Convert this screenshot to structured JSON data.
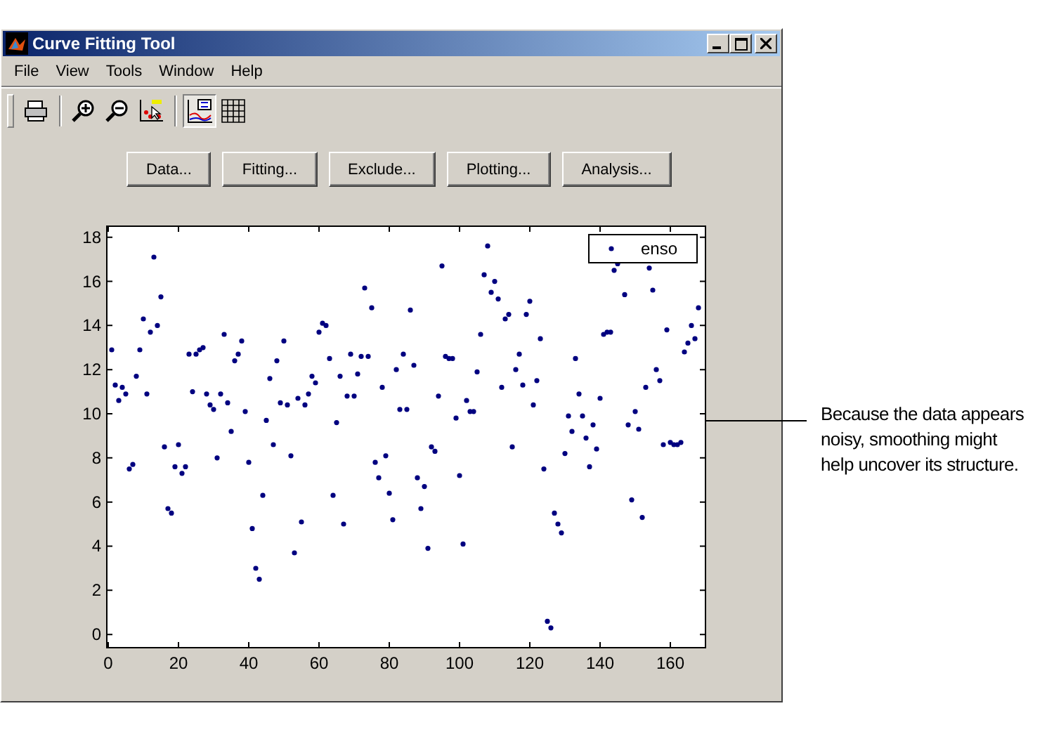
{
  "window": {
    "title": "Curve Fitting Tool"
  },
  "menu": [
    "File",
    "View",
    "Tools",
    "Window",
    "Help"
  ],
  "toolbar": [
    {
      "kind": "print",
      "pressed": false
    },
    {
      "kind": "zoom-in",
      "pressed": false
    },
    {
      "kind": "zoom-out",
      "pressed": false
    },
    {
      "kind": "data-cursor",
      "pressed": false
    },
    {
      "kind": "legend",
      "pressed": true
    },
    {
      "kind": "grid",
      "pressed": false
    }
  ],
  "buttons": [
    "Data...",
    "Fitting...",
    "Exclude...",
    "Plotting...",
    "Analysis..."
  ],
  "plot": {
    "chart_data": {
      "type": "scatter",
      "series": [
        {
          "name": "enso",
          "color": "#000080",
          "values": [
            12.9,
            11.3,
            10.6,
            11.2,
            10.9,
            7.5,
            7.7,
            11.7,
            12.9,
            14.3,
            10.9,
            13.7,
            17.1,
            14.0,
            15.3,
            8.5,
            5.7,
            5.5,
            7.6,
            8.6,
            7.3,
            7.6,
            12.7,
            11.0,
            12.7,
            12.9,
            13.0,
            10.9,
            10.4,
            10.2,
            8.0,
            10.9,
            13.6,
            10.5,
            9.2,
            12.4,
            12.7,
            13.3,
            10.1,
            7.8,
            4.8,
            3.0,
            2.5,
            6.3,
            9.7,
            11.6,
            8.6,
            12.4,
            10.5,
            13.3,
            10.4,
            8.1,
            3.7,
            10.7,
            5.1,
            10.4,
            10.9,
            11.7,
            11.4,
            13.7,
            14.1,
            14.0,
            12.5,
            6.3,
            9.6,
            11.7,
            5.0,
            10.8,
            12.7,
            10.8,
            11.8,
            12.6,
            15.7,
            12.6,
            14.8,
            7.8,
            7.1,
            11.2,
            8.1,
            6.4,
            5.2,
            12.0,
            10.2,
            12.7,
            10.2,
            14.7,
            12.2,
            7.1,
            5.7,
            6.7,
            3.9,
            8.5,
            8.3,
            10.8,
            16.7,
            12.6,
            12.5,
            12.5,
            9.8,
            7.2,
            4.1,
            10.6,
            10.1,
            10.1,
            11.9,
            13.6,
            16.3,
            17.6,
            15.5,
            16.0,
            15.2,
            11.2,
            14.3,
            14.5,
            8.5,
            12.0,
            12.7,
            11.3,
            14.5,
            15.1,
            10.4,
            11.5,
            13.4,
            7.5,
            0.6,
            0.3,
            5.5,
            5.0,
            4.6,
            8.2,
            9.9,
            9.2,
            12.5,
            10.9,
            9.9,
            8.9,
            7.6,
            9.5,
            8.4,
            10.7,
            13.6,
            13.7,
            13.7,
            16.5,
            16.8,
            15.4,
            9.5,
            6.1,
            10.1,
            9.3,
            5.3,
            11.2,
            16.6,
            15.6,
            12.0,
            11.5,
            8.6,
            13.8,
            8.7,
            8.6,
            8.6,
            8.7,
            12.8,
            13.2,
            14.0,
            13.4,
            14.8
          ]
        }
      ],
      "x": [
        1,
        2,
        3,
        4,
        5,
        6,
        7,
        8,
        9,
        10,
        11,
        12,
        13,
        14,
        15,
        16,
        17,
        18,
        19,
        20,
        21,
        22,
        23,
        24,
        25,
        26,
        27,
        28,
        29,
        30,
        31,
        32,
        33,
        34,
        35,
        36,
        37,
        38,
        39,
        40,
        41,
        42,
        43,
        44,
        45,
        46,
        47,
        48,
        49,
        50,
        51,
        52,
        53,
        54,
        55,
        56,
        57,
        58,
        59,
        60,
        61,
        62,
        63,
        64,
        65,
        66,
        67,
        68,
        69,
        70,
        71,
        72,
        73,
        74,
        75,
        76,
        77,
        78,
        79,
        80,
        81,
        82,
        83,
        84,
        85,
        86,
        87,
        88,
        89,
        90,
        91,
        92,
        93,
        94,
        95,
        96,
        97,
        98,
        99,
        100,
        101,
        102,
        103,
        104,
        105,
        106,
        107,
        108,
        109,
        110,
        111,
        112,
        113,
        114,
        115,
        116,
        117,
        118,
        119,
        120,
        121,
        122,
        123,
        124,
        125,
        126,
        127,
        128,
        129,
        130,
        131,
        132,
        133,
        134,
        135,
        136,
        137,
        138,
        139,
        140,
        141,
        142,
        143,
        144,
        145,
        147,
        148,
        149,
        150,
        151,
        152,
        153,
        154,
        155,
        156,
        157,
        158,
        159,
        160,
        161,
        162,
        163,
        164,
        165,
        166,
        167,
        168
      ],
      "xlim": [
        -0.4,
        170
      ],
      "ylim": [
        -0.6,
        18.5
      ],
      "xticks": [
        0,
        20,
        40,
        60,
        80,
        100,
        120,
        140,
        160
      ],
      "yticks": [
        0,
        2,
        4,
        6,
        8,
        10,
        12,
        14,
        16,
        18
      ]
    }
  },
  "callout": [
    "Because the data appears",
    "noisy, smoothing might",
    "help uncover its structure."
  ]
}
